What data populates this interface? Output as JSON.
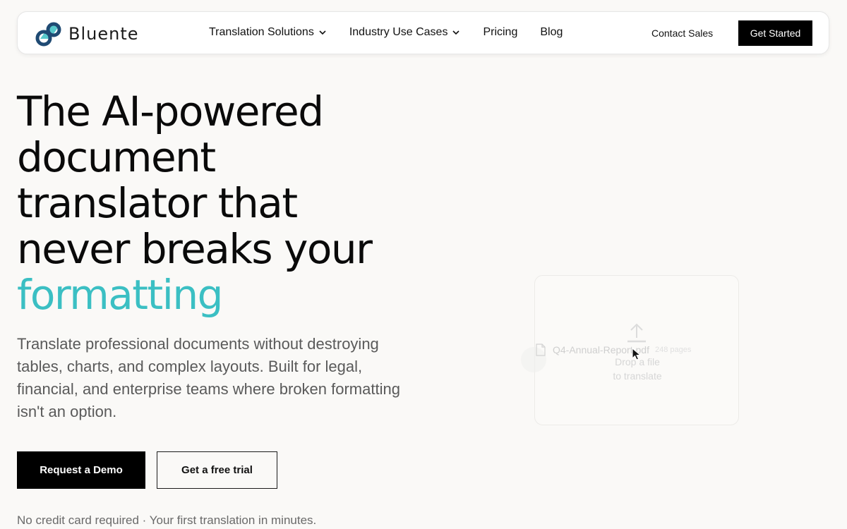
{
  "header": {
    "logo_text": "Bluente",
    "nav": [
      {
        "label": "Translation Solutions",
        "has_dropdown": true
      },
      {
        "label": "Industry Use Cases",
        "has_dropdown": true
      },
      {
        "label": "Pricing",
        "has_dropdown": false
      },
      {
        "label": "Blog",
        "has_dropdown": false
      }
    ],
    "contact_label": "Contact Sales",
    "get_started_label": "Get Started"
  },
  "hero": {
    "title_lines": [
      "The AI-powered",
      "document",
      "translator that",
      "never breaks your"
    ],
    "title_accent": "formatting",
    "subtitle": "Translate professional documents without destroying tables, charts, and complex layouts. Built for legal, financial, and enterprise teams where broken formatting isn't an option.",
    "demo_label": "Request a Demo",
    "trial_label": "Get a free trial",
    "note": "No credit card required · Your first translation in minutes."
  },
  "dropzone": {
    "line1": "Drop a file",
    "line2": "to translate",
    "file_name": "Q4-Annual-Report.pdf",
    "file_pages": "248 pages"
  },
  "colors": {
    "accent": "#3bbfc3",
    "logo_blue": "#1f4a73",
    "primary_button": "#000000",
    "background": "#faf9f7"
  },
  "icons": [
    "logo-mark-icon",
    "chevron-down-icon",
    "upload-icon",
    "file-icon",
    "cursor-icon"
  ]
}
